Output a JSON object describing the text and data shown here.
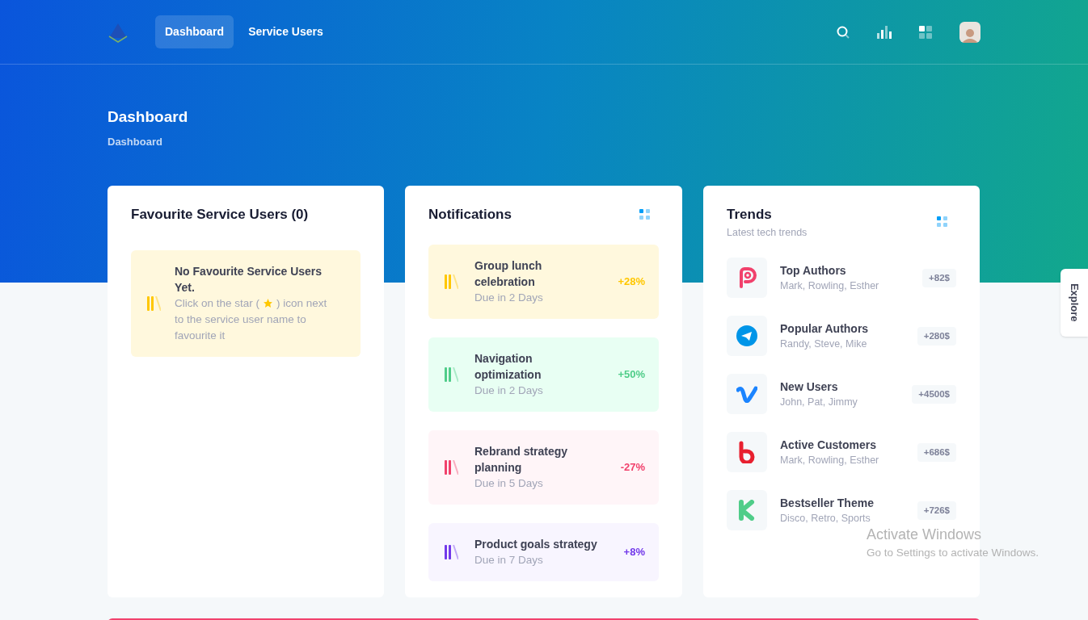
{
  "nav": {
    "items": [
      {
        "label": "Dashboard",
        "selected": true
      },
      {
        "label": "Service Users",
        "selected": false
      }
    ]
  },
  "page_title": "Dashboard",
  "breadcrumb": "Dashboard",
  "favourites": {
    "title": "Favourite Service Users (0)",
    "empty_title": "No Favourite Service Users Yet.",
    "hint_start": "Click on the star (",
    "hint_end": ") icon next",
    "hint_rest": "to the service user name to favourite it"
  },
  "notifications": {
    "title": "Notifications",
    "items": [
      {
        "kind": "warning",
        "title": "Group lunch celebration",
        "due": "Due in 2 Days",
        "change": "+28%"
      },
      {
        "kind": "success",
        "title": "Navigation optimization",
        "due": "Due in 2 Days",
        "change": "+50%"
      },
      {
        "kind": "danger",
        "title": "Rebrand strategy planning",
        "due": "Due in 5 Days",
        "change": "-27%"
      },
      {
        "kind": "info",
        "title": "Product goals strategy",
        "due": "Due in 7 Days",
        "change": "+8%"
      }
    ]
  },
  "trends": {
    "title": "Trends",
    "subtitle": "Latest tech trends",
    "items": [
      {
        "kind": "p",
        "title": "Top Authors",
        "names": "Mark, Rowling, Esther",
        "amount": "+82$"
      },
      {
        "kind": "plane",
        "title": "Popular Authors",
        "names": "Randy, Steve, Mike",
        "amount": "+280$"
      },
      {
        "kind": "v",
        "title": "New Users",
        "names": "John, Pat, Jimmy",
        "amount": "+4500$"
      },
      {
        "kind": "b",
        "title": "Active Customers",
        "names": "Mark, Rowling, Esther",
        "amount": "+686$"
      },
      {
        "kind": "k",
        "title": "Bestseller Theme",
        "names": "Disco, Retro, Sports",
        "amount": "+726$"
      }
    ]
  },
  "explore": "Explore",
  "os_notice": {
    "title": "Activate Windows",
    "text": "Go to Settings to activate Windows."
  }
}
